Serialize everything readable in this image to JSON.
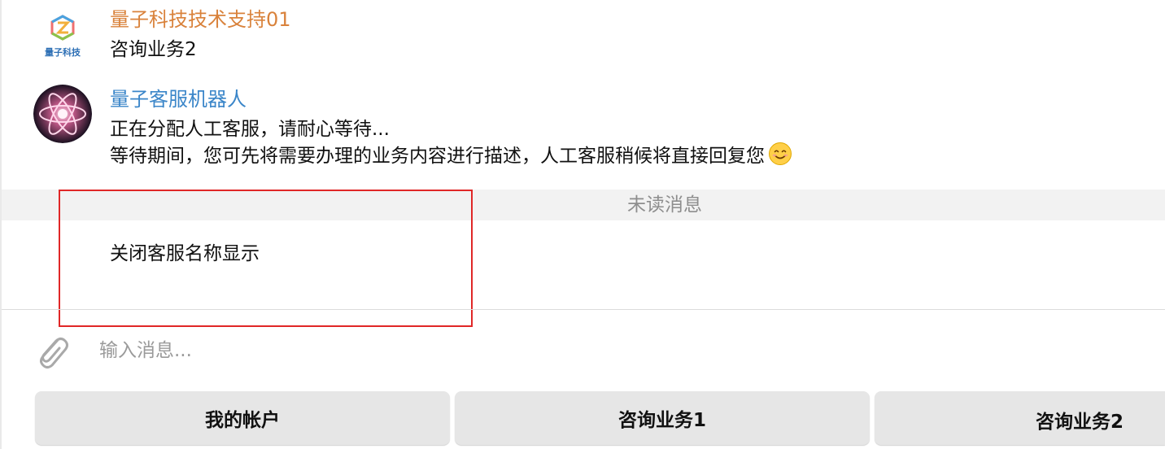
{
  "messages": [
    {
      "sender": "量子科技技术支持01",
      "sender_color": "#d9823b",
      "avatar_caption": "量子科技",
      "lines": [
        "咨询业务2"
      ]
    },
    {
      "sender": "量子客服机器人",
      "sender_color": "#3b86c9",
      "lines": [
        "正在分配人工客服，请耐心等待...",
        "等待期间，您可先将需要办理的业务内容进行描述，人工客服稍候将直接回复您"
      ]
    }
  ],
  "unread_divider": "未读消息",
  "system_notice": "关闭客服名称显示",
  "composer": {
    "placeholder": "输入消息...",
    "value": ""
  },
  "keyboard": {
    "buttons": [
      "我的帐户",
      "咨询业务1",
      "咨询业务2"
    ]
  },
  "colors": {
    "highlight_border": "#e02727",
    "keyboard_button_bg": "#e6e6e6",
    "unread_bar_bg": "#f2f2f2"
  }
}
